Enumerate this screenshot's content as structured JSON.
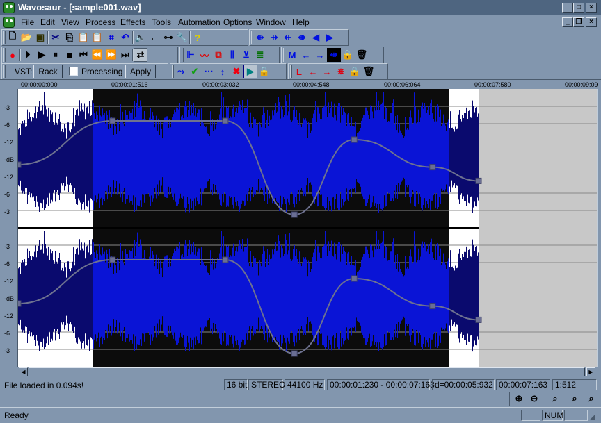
{
  "window": {
    "title": "Wavosaur - [sample001.wav]"
  },
  "menu": [
    "File",
    "Edit",
    "View",
    "Process",
    "Effects",
    "Tools",
    "Automation",
    "Options",
    "Window",
    "Help"
  ],
  "vst": {
    "label": "VST:",
    "rack": "Rack",
    "processing": "Processing",
    "processing_checked": false,
    "apply": "Apply"
  },
  "ruler": [
    "00:00:00:000",
    "00:00:01:516",
    "00:00:03:032",
    "00:00:04:548",
    "00:00:06:064",
    "00:00:07:580",
    "00:00:09:09"
  ],
  "db_labels": [
    "-3",
    "-6",
    "-12",
    "-dB",
    "-12",
    "-6",
    "-3"
  ],
  "info": {
    "message": "File loaded in 0.094s!",
    "bits": "16 bit",
    "channels": "STEREO",
    "rate": "44100 Hz",
    "selection": "00:00:01:230 - 00:00:07:163",
    "duration": "d=00:00:05:932",
    "cursor": "00:00:07:163",
    "zoom": "1:512"
  },
  "status": {
    "text": "Ready",
    "num": "NUM"
  },
  "colors": {
    "selection_bg": "#0c0c0c",
    "wave_selected": "#0a14d6",
    "wave_unselected": "#0a0a6e",
    "envelope": "#6e7290",
    "empty": "#c8c8c8"
  },
  "envelope_points": [
    [
      0,
      0.55
    ],
    [
      0.205,
      0.2
    ],
    [
      0.45,
      0.2
    ],
    [
      0.6,
      0.95
    ],
    [
      0.73,
      0.35
    ],
    [
      0.9,
      0.57
    ],
    [
      1.0,
      0.68
    ]
  ]
}
